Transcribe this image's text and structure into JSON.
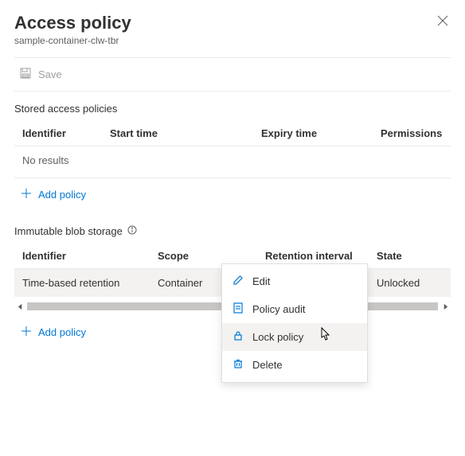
{
  "header": {
    "title": "Access policy",
    "subtitle": "sample-container-clw-tbr"
  },
  "toolbar": {
    "save_label": "Save"
  },
  "stored": {
    "section_title": "Stored access policies",
    "cols": {
      "identifier": "Identifier",
      "start": "Start time",
      "expiry": "Expiry time",
      "permissions": "Permissions"
    },
    "no_results": "No results",
    "add_label": "Add policy"
  },
  "immutable": {
    "section_title": "Immutable blob storage",
    "cols": {
      "identifier": "Identifier",
      "scope": "Scope",
      "retention": "Retention interval",
      "state": "State"
    },
    "row": {
      "identifier": "Time-based retention",
      "scope": "Container",
      "retention": "",
      "state": "Unlocked"
    },
    "add_label": "Add policy"
  },
  "menu": {
    "edit": "Edit",
    "audit": "Policy audit",
    "lock": "Lock policy",
    "delete": "Delete"
  }
}
